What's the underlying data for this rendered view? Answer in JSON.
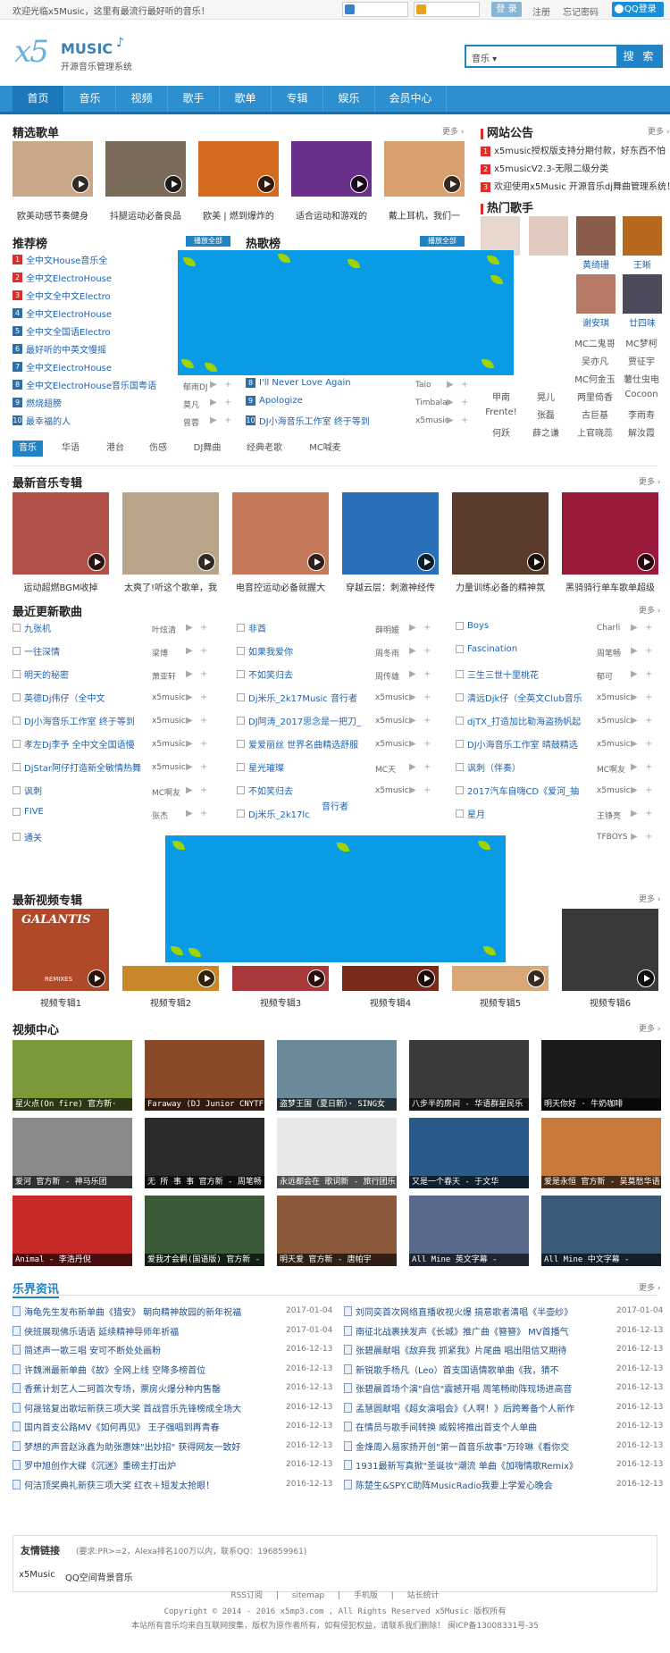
{
  "topbar": {
    "welcome": "欢迎光临x5Music，这里有最流行最好听的音乐！",
    "login_button": "登 录",
    "register": "注册",
    "forgot": "忘记密码",
    "qq_login": "QQ登录"
  },
  "header": {
    "logo_main": "x5",
    "logo_music": "MUSIC",
    "logo_sub": "开源音乐管理系统",
    "search_category": "音乐 ▾",
    "search_button": "搜 索"
  },
  "nav": [
    "首页",
    "音乐",
    "视频",
    "歌手",
    "歌单",
    "专辑",
    "娱乐",
    "会员中心"
  ],
  "featured": {
    "title": "精选歌单",
    "more": "更多",
    "items": [
      {
        "caption": "欧美动感节奏健身",
        "color": "#c9a88a"
      },
      {
        "caption": "抖腿运动必备良品",
        "color": "#7a6a5a"
      },
      {
        "caption": "欧美 | 燃到爆炸的",
        "color": "#d46a1e"
      },
      {
        "caption": "适合运动和游戏的",
        "color": "#6a2f8a"
      },
      {
        "caption": "戴上耳机，我们一",
        "color": "#d8a070"
      }
    ]
  },
  "notice": {
    "title": "网站公告",
    "more": "更多",
    "items": [
      "x5music授权版支持分期付款，好东西不怕",
      "x5musicV2.3-无限二级分类",
      "欢迎使用x5Music 开源音乐dj舞曲管理系统！"
    ]
  },
  "hot_singers": {
    "title": "热门歌手",
    "photo_singers": [
      {
        "name": "",
        "color": "#e8d7cc"
      },
      {
        "name": "",
        "color": "#e0c9be"
      },
      {
        "name": "黄绮珊",
        "color": "#8a5a4a"
      },
      {
        "name": "王晰",
        "color": "#b5681e"
      },
      {
        "name": "谢安琪",
        "color": "#b87a68"
      },
      {
        "name": "廿四味",
        "color": "#4a4a5a"
      }
    ],
    "text_rows": [
      [
        "MC二鬼哥",
        "MC梦柯"
      ],
      [
        "吴亦凡",
        "贾征宇"
      ],
      [
        "MC何金玉",
        "薯仕虫电"
      ]
    ]
  },
  "recommend": {
    "title": "推荐榜",
    "hot_title": "热歌榜",
    "play_all": "播放全部",
    "list": [
      {
        "num": "1",
        "title": "全中文House音乐全"
      },
      {
        "num": "2",
        "title": "全中文ElectroHouse"
      },
      {
        "num": "3",
        "title": "全中文全中文Electro"
      },
      {
        "num": "4",
        "title": "全中文ElectroHouse"
      },
      {
        "num": "5",
        "title": "全中文全国语Electro"
      },
      {
        "num": "6",
        "title": "最好听的中英文慢摇"
      },
      {
        "num": "7",
        "title": "全中文ElectroHouse"
      },
      {
        "num": "8",
        "title": "全中文ElectroHouse音乐国粤语",
        "artist": "郁雨DJ"
      },
      {
        "num": "9",
        "title": "燃烧翅膀",
        "artist": "莫凡"
      },
      {
        "num": "10",
        "title": "最幸福的人",
        "artist": "曾蓉"
      }
    ],
    "hot_list": [
      {
        "num": "8",
        "title": "I'll Never Love Again",
        "artist": "Taio"
      },
      {
        "num": "9",
        "title": "Apologize",
        "artist": "Timbalar"
      },
      {
        "num": "10",
        "title": "DJ小海音乐工作室 终于等到",
        "artist": "x5music"
      }
    ],
    "side_artists": [
      [
        "甲南",
        "晃儿"
      ],
      [
        "Frente!",
        "张磊"
      ],
      [
        "何跃",
        "薛之谦"
      ]
    ],
    "side_artists2": [
      [
        "两里倚香",
        "Cocoon"
      ],
      [
        "古巨基",
        "李雨寿"
      ],
      [
        "上官晓蕊",
        "解汝霞"
      ]
    ]
  },
  "category_tabs": [
    "音乐",
    "华语",
    "港台",
    "伤感",
    "DJ舞曲",
    "经典老歌",
    "MC喊麦"
  ],
  "albums": {
    "title": "最新音乐专辑",
    "more": "更多",
    "items": [
      {
        "caption": "运动超燃BGM收掉",
        "color": "#b2504a"
      },
      {
        "caption": "太爽了!听这个歌单，我",
        "color": "#b8a488"
      },
      {
        "caption": "电音控运动必备就握大",
        "color": "#c47a5a"
      },
      {
        "caption": "穿越云层：刺激神经传",
        "color": "#2a6fb8"
      },
      {
        "caption": "力量训练必备的精神氛",
        "color": "#5a3a2a"
      },
      {
        "caption": "黑骑骑行单车歌单超级",
        "color": "#9a1a3a"
      }
    ]
  },
  "updates": {
    "title": "最近更新歌曲",
    "more": "更多",
    "col1": [
      {
        "title": "九张机",
        "artist": "叶炫清"
      },
      {
        "title": "一往深情",
        "artist": "梁博"
      },
      {
        "title": "明天的秘密",
        "artist": "萧亚轩"
      },
      {
        "title": "英德Dj伟仔（全中文",
        "artist": "x5music"
      },
      {
        "title": "DJ小海音乐工作室 终于等到",
        "artist": "x5music"
      },
      {
        "title": "孝左Dj李予 全中文全国语慢",
        "artist": "x5music"
      },
      {
        "title": "DjStar阿仔打造新全敏情热舞",
        "artist": "x5music"
      },
      {
        "title": "讽刺",
        "artist": "MC啊友"
      },
      {
        "title": "FIVE",
        "artist": "张杰"
      },
      {
        "title": "通关",
        "artist": ""
      }
    ],
    "col2": [
      {
        "title": "非酋",
        "artist": "薛明媛"
      },
      {
        "title": "如果我爱你",
        "artist": "周冬雨"
      },
      {
        "title": "不如笑归去",
        "artist": "周传雄"
      },
      {
        "title": "Dj米乐_2k17Music 音行者",
        "artist": "x5music"
      },
      {
        "title": "DJ阿涛_2017思念是一把刀_",
        "artist": "x5music"
      },
      {
        "title": "爱爱丽丝 世界名曲精选舒服",
        "artist": "x5music"
      },
      {
        "title": "星光璀璨",
        "artist": "MC天"
      },
      {
        "title": "不如笑归去",
        "artist": "x5music"
      },
      {
        "title": "Dj米乐_2k17lc",
        "artist": ""
      }
    ],
    "col2_extra": "音行者",
    "col3": [
      {
        "title": "Boys",
        "artist": "Charli"
      },
      {
        "title": "Fascination",
        "artist": "周笔畅"
      },
      {
        "title": "三生三世十里桃花",
        "artist": "郁可"
      },
      {
        "title": "清远Djk仔（全英文Club音乐",
        "artist": "x5music"
      },
      {
        "title": "djTX_打造加比勒海盗扬帆起",
        "artist": "x5music"
      },
      {
        "title": "DJ小海音乐工作室 晴鼓精选",
        "artist": "x5music"
      },
      {
        "title": "讽刺（伴奏）",
        "artist": "MC啊友"
      },
      {
        "title": "2017汽车自嗨CD《爱河_抽",
        "artist": "x5music"
      },
      {
        "title": "星月",
        "artist": "王铮亮"
      },
      {
        "title": "",
        "artist": "TFBOYS"
      }
    ]
  },
  "video_albums": {
    "title": "最新视频专辑",
    "more": "更多",
    "items": [
      {
        "caption": "视频专辑1",
        "color": "#b0482a"
      },
      {
        "caption": "视频专辑2",
        "color": "#c8882a"
      },
      {
        "caption": "视频专辑3",
        "color": "#a8383a"
      },
      {
        "caption": "视频专辑4",
        "color": "#7a2a1a"
      },
      {
        "caption": "视频专辑5",
        "color": "#d8a878"
      },
      {
        "caption": "视频专辑6",
        "color": "#3a3a3a"
      }
    ],
    "overlay_text": "GALANTIS",
    "overlay_sub": "REMIXES"
  },
  "videos": {
    "title": "视频中心",
    "more": "更多",
    "items": [
      {
        "caption": "星火点(On fire) 官方新·",
        "color": "#7a9a3a"
      },
      {
        "caption": "Faraway (DJ Junior CNYTF",
        "color": "#8a4a2a"
      },
      {
        "caption": "盗梦王国（夏日新）· SING女",
        "color": "#6a8a9a"
      },
      {
        "caption": "八步半的房间 - 华语群星民乐",
        "color": "#3a3a3a"
      },
      {
        "caption": "明天你好 · 牛奶咖啡",
        "color": "#1a1a1a"
      },
      {
        "caption": "爱河 官方新 - 神马乐团",
        "color": "#8a8a8a"
      },
      {
        "caption": "无 所 事 事 官方新 - 周笔畅",
        "color": "#2a2a2a"
      },
      {
        "caption": "永远都会在 歌词新 - 旅行团乐",
        "color": "#e8e8e8"
      },
      {
        "caption": "又是一个春天 - 于文华",
        "color": "#2a5a8a"
      },
      {
        "caption": "爱是永恒 官方新 - 吴莫愁华语",
        "color": "#c8783a"
      },
      {
        "caption": "Animal - 李浩丹倪",
        "color": "#c82a2a"
      },
      {
        "caption": "爱我才会羁(国语版) 官方新 -",
        "color": "#3a5a3a"
      },
      {
        "caption": "明天爱 官方新 - 唐帕宇",
        "color": "#8a5a3a"
      },
      {
        "caption": "All Mine 英文字幕 -",
        "color": "#5a6a8a"
      },
      {
        "caption": "All Mine 中文字幕 -",
        "color": "#3a5a7a"
      }
    ]
  },
  "news": {
    "title": "乐界资讯",
    "more": "更多",
    "left": [
      {
        "title": "海龟先生发布新单曲《猎安》 朝向精神故园的新年祝福",
        "date": "2017-01-04"
      },
      {
        "title": "侠班展现佛乐语语 延续精神导师年祈福",
        "date": "2017-01-04"
      },
      {
        "title": "简述声一歌三唱 安可不断处处画粉",
        "date": "2016-12-13"
      },
      {
        "title": "许魏洲最新单曲《故》全网上线 空降多榜首位",
        "date": "2016-12-13"
      },
      {
        "title": "香蕉计划艺人二珂首次专场，票房火爆分种内售罄",
        "date": "2016-12-13"
      },
      {
        "title": "何晟铭复出歌坛新获三项大奖 首战音乐先锋榜成全场大",
        "date": "2016-12-13"
      },
      {
        "title": "国内首支公路MV《如何再见》 王子强唱到再青春",
        "date": "2016-12-13"
      },
      {
        "title": "梦想的声音赵泳鑫为助张惠妹\"出妙招\" 获得网友一致好",
        "date": "2016-12-13"
      },
      {
        "title": "罗中旭创作大碟《沉迷》重磅主打出炉",
        "date": "2016-12-13"
      },
      {
        "title": "何洁顶奖典礼新获三项大奖 红衣＋短发太抢眼！",
        "date": "2016-12-13"
      }
    ],
    "right": [
      {
        "title": "刘同奕首次网络直播收视火爆 搞意歌者清唱《半壶纱》",
        "date": "2017-01-04"
      },
      {
        "title": "南征北战裹挟发声《长城》推广曲《簪簪》 MV首播气",
        "date": "2016-12-13"
      },
      {
        "title": "张碧晨献唱《敌弃我 抓紧我》片尾曲 唱出阻信又期待",
        "date": "2016-12-13"
      },
      {
        "title": "新锐歌手杨凡（Leo）首支国语情歌单曲《我，猜不",
        "date": "2016-12-13"
      },
      {
        "title": "张碧晨首场个演\"自信\"震撼开唱 周笔畅助阵现场进高音",
        "date": "2016-12-13"
      },
      {
        "title": "孟慧圆献唱《超女演唱会》《人啊！》后跨筹备个人新作",
        "date": "2016-12-13"
      },
      {
        "title": "在情员与歌手间转换 威毅将推出首支个人单曲",
        "date": "2016-12-13"
      },
      {
        "title": "金烽周入易家扬开创\"第一首音乐故事\"万玲琳《看你交",
        "date": "2016-12-13"
      },
      {
        "title": "1931最新写真掀\"圣诞妆\"潮流 单曲《加嗨情歌Remix》",
        "date": "2016-12-13"
      },
      {
        "title": "陈楚生&SPY.C助阵MusicRadio我要上学爱心晚会",
        "date": "2016-12-13"
      }
    ]
  },
  "friend_links": {
    "title": "友情链接",
    "note": "(要求:PR>=2，Alexa排名100万以内，联系QQ：196859961)",
    "links": [
      "x5Music",
      "QQ空间背景音乐"
    ]
  },
  "footer": {
    "links": [
      "RSS订阅",
      "|",
      "sitemap",
      "|",
      "手机版",
      "|",
      "站长统计"
    ],
    "copyright": "Copyright © 2014 - 2016 x5mp3.com , All Rights Reserved x5Music 版权所有",
    "disclaimer": "本站所有音乐均来自互联网搜集，版权为原作者所有，如有侵犯权益，请联系我们删除！ 闽ICP备13008331号-35"
  },
  "colors": {
    "brand": "#1f83c6",
    "nav_bg": "#2d8fd0",
    "ad_bg": "#0a9be6",
    "leaf": "#9fd400",
    "rank_hot": "#d9302f",
    "rank_normal": "#2d6da8"
  }
}
